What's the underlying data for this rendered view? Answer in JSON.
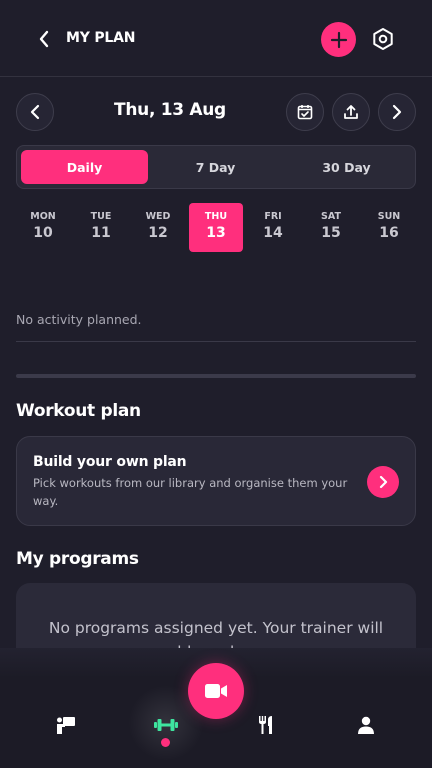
{
  "header": {
    "title": "MY PLAN",
    "back_icon": "chevron-left-icon",
    "add_icon": "plus-icon",
    "settings_icon": "hexagon-settings-icon"
  },
  "date_nav": {
    "date_label": "Thu, 13 Aug"
  },
  "range_tabs": [
    {
      "label": "Daily",
      "active": true
    },
    {
      "label": "7 Day",
      "active": false
    },
    {
      "label": "30 Day",
      "active": false
    }
  ],
  "week": [
    {
      "name": "MON",
      "num": "10",
      "active": false
    },
    {
      "name": "TUE",
      "num": "11",
      "active": false
    },
    {
      "name": "WED",
      "num": "12",
      "active": false
    },
    {
      "name": "THU",
      "num": "13",
      "active": true
    },
    {
      "name": "FRI",
      "num": "14",
      "active": false
    },
    {
      "name": "SAT",
      "num": "15",
      "active": false
    },
    {
      "name": "SUN",
      "num": "16",
      "active": false
    }
  ],
  "activity": {
    "empty_text": "No activity planned."
  },
  "workout_plan": {
    "section_title": "Workout plan",
    "card_title": "Build your own plan",
    "card_desc": "Pick workouts from our library and organise them your way."
  },
  "programs": {
    "section_title": "My programs",
    "empty_text": "No programs assigned yet. Your trainer will add one here."
  },
  "colors": {
    "accent": "#ff2f7d",
    "background": "#1f1e2b",
    "card": "#292837"
  }
}
